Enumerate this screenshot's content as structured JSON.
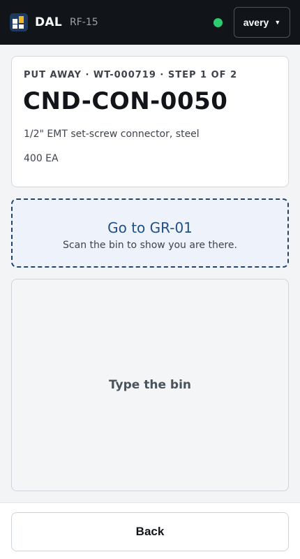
{
  "header": {
    "brand": "DAL",
    "device": "RF-15",
    "status_color": "#2ecc71",
    "user": "avery",
    "user_caret": "▼"
  },
  "task": {
    "eyebrow": "PUT AWAY · WT-000719 · STEP 1 OF 2",
    "sku": "CND-CON-0050",
    "description": "1/2\" EMT set-screw connector, steel",
    "quantity": "400 EA"
  },
  "goto": {
    "title": "Go to GR-01",
    "subtitle": "Scan the bin to show you are there."
  },
  "input_panel": {
    "label": "Type the bin"
  },
  "footer": {
    "back_label": "Back"
  },
  "colors": {
    "topbar": "#111418",
    "accent": "#1f4f85",
    "logo_accent": "#f0b429"
  }
}
